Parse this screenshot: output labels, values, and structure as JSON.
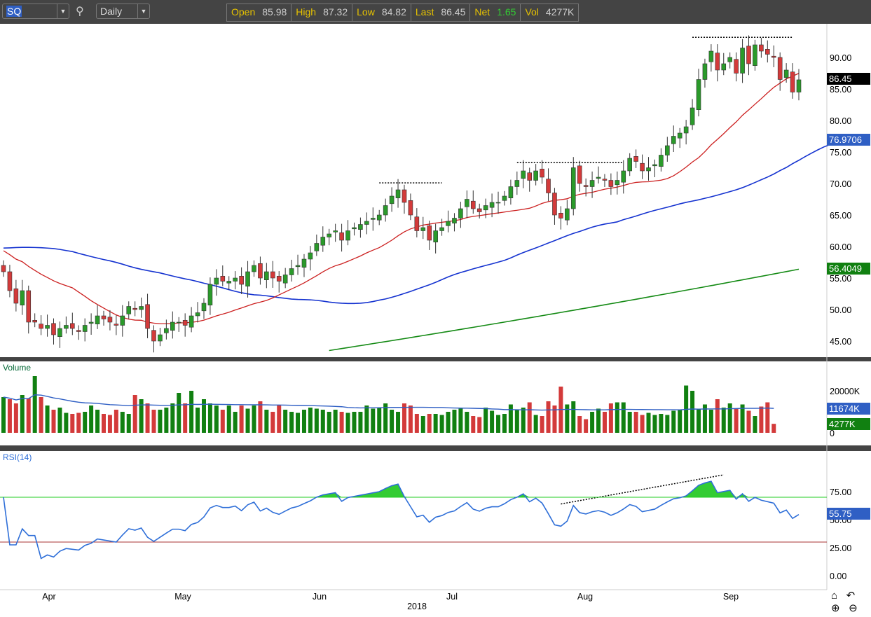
{
  "toolbar": {
    "symbol": "SQ",
    "period": "Daily",
    "quote": [
      {
        "label": "Open",
        "value": "85.98"
      },
      {
        "label": "High",
        "value": "87.32"
      },
      {
        "label": "Low",
        "value": "84.82"
      },
      {
        "label": "Last",
        "value": "86.45"
      },
      {
        "label": "Net",
        "value": "1.65"
      },
      {
        "label": "Vol",
        "value": "4277K"
      }
    ]
  },
  "panels": {
    "volume_label": "Volume",
    "rsi_label": "RSI(14)"
  },
  "tags": {
    "last": "86.45",
    "ma50": "76.9706",
    "ma200": "56.4049",
    "vol_avg": "11674K",
    "vol_last": "4277K",
    "rsi": "55.75"
  },
  "nav": {
    "home": "home-icon",
    "undo": "undo-icon",
    "zoom_in": "zoom-in-icon",
    "zoom_out": "zoom-out-icon"
  },
  "colors": {
    "up": "#2a9a2a",
    "down": "#d33a3a",
    "ma20": "#cc2020",
    "ma50": "#1533d0",
    "ma200": "#148a14",
    "rsi": "#2f6fd8"
  },
  "chart_data": {
    "type": "candlestick",
    "title": "SQ Daily",
    "x_month_labels": [
      "Apr",
      "May",
      "Jun",
      "Jul",
      "Aug",
      "Sep"
    ],
    "x_year_label": "2018",
    "price_ticks": [
      "90.00",
      "85.00",
      "80.00",
      "75.00",
      "70.00",
      "65.00",
      "60.00",
      "55.00",
      "50.00",
      "45.00"
    ],
    "price_range": [
      43,
      95
    ],
    "volume_ticks": [
      "20000K",
      "0"
    ],
    "rsi_ticks": [
      "75.00",
      "50.00",
      "25.00",
      "0.00"
    ],
    "closes": [
      56,
      53,
      51,
      53,
      48,
      48,
      47,
      47.5,
      46,
      47,
      47.5,
      47,
      46.5,
      47.5,
      48,
      49,
      48.5,
      48,
      47.5,
      49,
      50.5,
      50,
      50.5,
      47,
      45,
      46,
      47,
      48,
      48,
      47.5,
      49,
      49.5,
      51,
      54,
      55,
      54.5,
      54.5,
      55,
      54,
      56,
      57,
      55,
      56,
      55,
      54.5,
      55.5,
      56.5,
      57,
      58,
      59,
      60.5,
      61.5,
      62,
      62.5,
      61,
      62.5,
      63,
      63.5,
      64,
      64.5,
      65,
      66.5,
      68,
      69,
      67,
      65,
      62.5,
      63,
      61,
      62.5,
      63,
      64,
      64.5,
      66,
      67.5,
      66,
      65.5,
      66.5,
      67,
      67,
      68,
      69.5,
      70.5,
      72,
      70.5,
      72,
      71,
      68.5,
      65,
      64.5,
      66,
      72.5,
      70,
      69.5,
      70.5,
      71,
      70.5,
      69.5,
      70.5,
      72,
      74,
      73.5,
      72,
      72.5,
      73,
      74.5,
      76,
      77.5,
      78,
      79,
      82,
      86.5,
      89,
      91,
      88,
      89,
      90,
      87.5,
      91.5,
      89,
      92,
      91,
      90.5,
      90,
      86.5,
      88,
      84.5,
      86.45
    ],
    "volumes_k": [
      17000,
      16000,
      14000,
      18000,
      16500,
      27000,
      17000,
      13000,
      11000,
      12000,
      9500,
      9000,
      9500,
      10000,
      13000,
      11000,
      9000,
      8500,
      11000,
      10000,
      9000,
      18000,
      16000,
      14000,
      11000,
      11000,
      12000,
      14000,
      19000,
      14000,
      20000,
      12000,
      16000,
      14000,
      13000,
      11000,
      13000,
      10000,
      13000,
      11500,
      13000,
      15000,
      11000,
      10000,
      13000,
      11000,
      10000,
      9500,
      11000,
      12000,
      11500,
      11000,
      10000,
      11000,
      10000,
      9500,
      10000,
      10000,
      13000,
      11500,
      12000,
      14000,
      11000,
      10000,
      14000,
      13000,
      9000,
      8000,
      9000,
      9000,
      8500,
      10000,
      11000,
      11500,
      10000,
      8000,
      7500,
      12000,
      10500,
      8500,
      9000,
      13500,
      11000,
      12000,
      14500,
      8500,
      8000,
      15000,
      13000,
      22000,
      13500,
      15000,
      8000,
      6500,
      10000,
      11500,
      10000,
      14000,
      14500,
      14500,
      10000,
      10000,
      8500,
      9500,
      8500,
      9000,
      8500,
      10500,
      11000,
      22500,
      20000,
      11500,
      13500,
      11000,
      16000,
      12000,
      14000,
      11500,
      13500,
      10500,
      8000,
      12500,
      14500,
      4277
    ],
    "ma200_endpoints": [
      43.5,
      56.4
    ],
    "rsi_levels": [
      70,
      30
    ],
    "annotations": [
      {
        "type": "resistance",
        "price": 70.1,
        "from_bar": 60,
        "to_bar": 70
      },
      {
        "type": "resistance",
        "price": 73.3,
        "from_bar": 82,
        "to_bar": 99
      },
      {
        "type": "resistance",
        "price": 93.2,
        "from_bar": 110,
        "to_bar": 126
      },
      {
        "type": "rsi_trend",
        "from": [
          89,
          64
        ],
        "to": [
          115,
          90
        ]
      }
    ]
  }
}
